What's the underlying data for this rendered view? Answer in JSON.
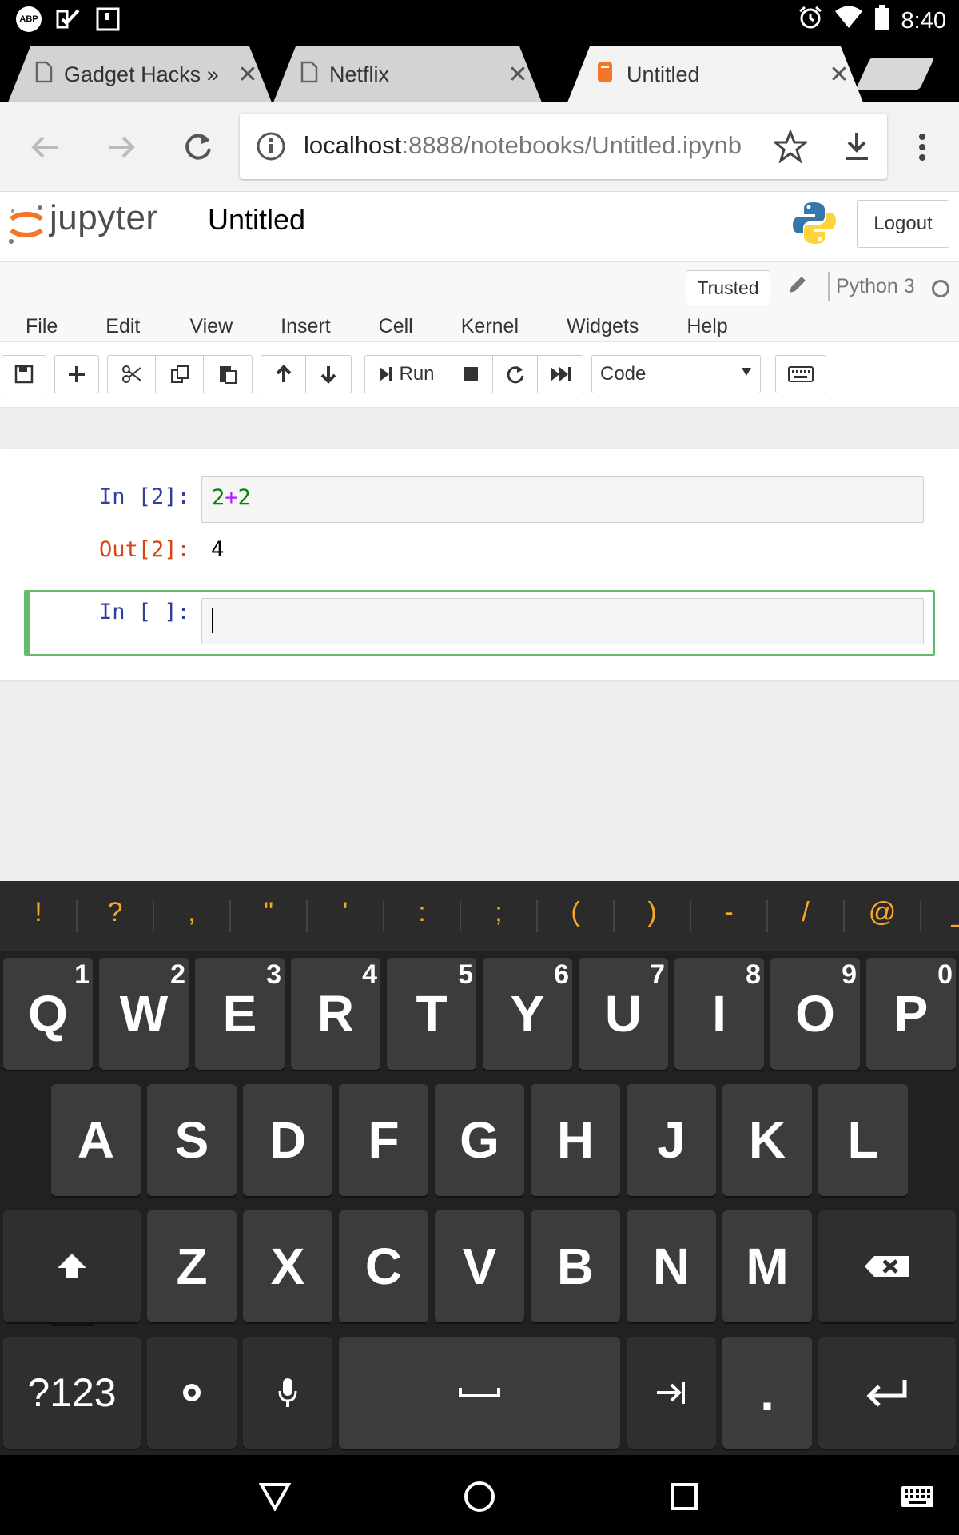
{
  "status_bar": {
    "time": "8:40",
    "left_icons": [
      "abp-icon",
      "checkmark-icon",
      "notification-icon"
    ],
    "abp_label": "ABP",
    "right_icons": [
      "alarm-icon",
      "wifi-icon",
      "battery-icon"
    ]
  },
  "tabs": [
    {
      "title": "Gadget Hacks »",
      "icon": "page-icon",
      "active": false
    },
    {
      "title": "Netflix",
      "icon": "page-icon",
      "active": false
    },
    {
      "title": "Untitled",
      "icon": "jupyter-favicon",
      "active": true
    }
  ],
  "tab_close_glyph": "✕",
  "address_bar": {
    "host": "localhost",
    "rest": ":8888/notebooks/Untitled.ipynb"
  },
  "jupyter": {
    "logo_text": "jupyter",
    "notebook_title": "Untitled",
    "logout_label": "Logout",
    "trusted_label": "Trusted",
    "kernel_name": "Python 3",
    "menus": [
      "File",
      "Edit",
      "View",
      "Insert",
      "Cell",
      "Kernel",
      "Widgets",
      "Help"
    ],
    "run_label": "Run",
    "cell_type": "Code",
    "cells": [
      {
        "prompt": "In [2]:",
        "code_a": "2",
        "code_op": "+",
        "code_b": "2",
        "out_prompt": "Out[2]:",
        "output": "4"
      },
      {
        "prompt": "In [ ]:",
        "code": ""
      }
    ],
    "colors": {
      "selected_border": "#66bb6a",
      "in_prompt": "#303f9f",
      "out_prompt": "#d84315",
      "number": "#008800",
      "operator": "#aa22ff"
    }
  },
  "keyboard": {
    "suggestions": [
      "!",
      "?",
      ",",
      "\"",
      "'",
      ":",
      ";",
      "(",
      ")",
      "-",
      "/",
      "@",
      "_"
    ],
    "row1": [
      {
        "k": "Q",
        "h": "1"
      },
      {
        "k": "W",
        "h": "2"
      },
      {
        "k": "E",
        "h": "3"
      },
      {
        "k": "R",
        "h": "4"
      },
      {
        "k": "T",
        "h": "5"
      },
      {
        "k": "Y",
        "h": "6"
      },
      {
        "k": "U",
        "h": "7"
      },
      {
        "k": "I",
        "h": "8"
      },
      {
        "k": "O",
        "h": "9"
      },
      {
        "k": "P",
        "h": "0"
      }
    ],
    "row2": [
      "A",
      "S",
      "D",
      "F",
      "G",
      "H",
      "J",
      "K",
      "L"
    ],
    "row3": [
      "Z",
      "X",
      "C",
      "V",
      "B",
      "N",
      "M"
    ],
    "symbols_label": "?123",
    "period_label": ".",
    "accent": "#f9a825"
  },
  "nav_bar": {
    "buttons": [
      "back-triangle-icon",
      "home-circle-icon",
      "recents-square-icon",
      "keyboard-switch-icon"
    ]
  }
}
